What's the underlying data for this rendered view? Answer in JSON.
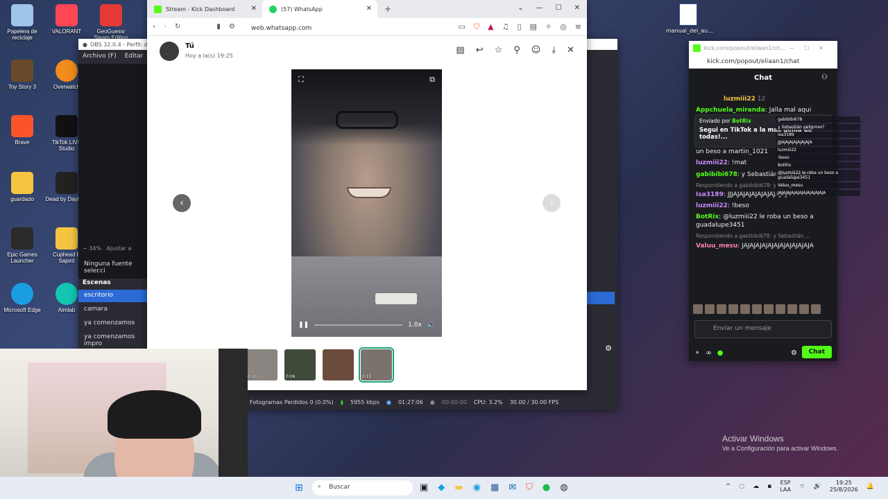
{
  "desktop": {
    "icons": [
      {
        "label": "Papelera de reciclaje",
        "color": "#9fc5e8"
      },
      {
        "label": "VALORANT",
        "color": "#ff4655"
      },
      {
        "label": "GeoGuessr Steam Edition",
        "color": "#e53935"
      },
      {
        "label": "Toy Story 3",
        "color": "#6a4a2a"
      },
      {
        "label": "Overwatch",
        "color": "#f28c1d"
      },
      {
        "label": "Brave",
        "color": "#fb542b"
      },
      {
        "label": "TikTok LIVE Studio",
        "color": "#111111"
      },
      {
        "label": "guardado",
        "color": "#f5c542"
      },
      {
        "label": "Dead by Daylight",
        "color": "#222222"
      },
      {
        "label": "Epic Games Launcher",
        "color": "#2a2a2a"
      },
      {
        "label": "Cuphead B Sajord",
        "color": "#f5c542"
      },
      {
        "label": "Microsoft Edge",
        "color": "#1b9de2"
      },
      {
        "label": "Aimlab",
        "color": "#13c6b3"
      }
    ],
    "file_icon": "manual_del_au...",
    "activate": {
      "title": "Activar Windows",
      "subtitle": "Ve a Configuración para activar Windows."
    }
  },
  "obs": {
    "title": "OBS 32.0.4 - Perfil: dir",
    "menu": [
      "Archivo (F)",
      "Editar",
      "V"
    ],
    "zoom": "34%",
    "zoom_label": "Ajustar a",
    "no_source": "Ninguna fuente selecci",
    "scenes_title": "Escenas",
    "scenes": [
      "escritorio",
      "camara",
      "ya comenzamos",
      "ya comenzamos impro"
    ],
    "status": {
      "dropped": "Fotogramas Perdidos 0 (0.0%)",
      "bitrate": "5955 kbps",
      "live_time": "01:27:06",
      "rec_time": "00:00:00",
      "cpu": "CPU: 3.2%",
      "fps": "30.00 / 30.00 FPS"
    }
  },
  "browser": {
    "tabs": [
      {
        "label": "Stream - Kick Dashboard",
        "color": "#53fc18"
      },
      {
        "label": "(57) WhatsApp",
        "color": "#25d366"
      }
    ],
    "url": "web.whatsapp.com"
  },
  "whatsapp": {
    "sender": "Tú",
    "time": "Hoy a la(s) 19:25",
    "video": {
      "speed": "1.0x",
      "progress": 0.0
    },
    "thumbs": [
      {
        "dur": "0:10",
        "color": "#8a8580"
      },
      {
        "dur": "0:06",
        "color": "#3f4a3a"
      },
      {
        "dur": "",
        "color": "#6a4b3c"
      },
      {
        "dur": "0:15",
        "color": "#7a726c"
      }
    ]
  },
  "kick": {
    "window_title": "kick.com/popout/eliaan1/ch...",
    "url": "kick.com/popout/eliaan1/chat",
    "header": "Chat",
    "pinned": {
      "by_label": "Enviado por",
      "by_user": "BotRix",
      "text": "Segui en TikTok a la mas genia de todas!..."
    },
    "messages": [
      {
        "user": "luzmiii22",
        "text": "12",
        "color": "#f5c542"
      },
      {
        "user": "Appchuela_miranda",
        "text": "Jalla mal aqui",
        "color": "#53fc18"
      },
      {
        "user": "",
        "text": "un beso a martin_1021",
        "color": "#eeeeee"
      },
      {
        "user": "luzmiii22",
        "text": "!mat",
        "color": "#c98bff"
      },
      {
        "user": "gabibibi678",
        "text": "y Sebastián peligroso?",
        "color": "#53fc18"
      },
      {
        "user": "Isa3189",
        "text": "JJJAJAJAJAJAJAJAJAJAJA",
        "color": "#c98bff",
        "reply": "Respondiendo a gabibibi678: y Sebastián ..."
      },
      {
        "user": "luzmiii22",
        "text": "!beso",
        "color": "#c98bff"
      },
      {
        "user": "BotRix",
        "text": "@luzmiii22 le roba un beso a guadalupe3451",
        "color": "#53fc18"
      },
      {
        "user": "Valuu_mesu",
        "text": "JAJAJAJAJAJAJAJAJAJAJAJA",
        "color": "#ff7eb6",
        "reply": "Respondiendo a gabibibi678: y Sebastián ..."
      }
    ],
    "overlay": [
      "gabibibi678",
      "y Sebastián peligroso?",
      "isa3189",
      "JJJAJAJAJAJAJAJAJA",
      "luzmiii22",
      "!beso",
      "BotRix",
      "@luzmiii22 le roba un beso a guadalupe3451",
      "Valuu_mesu",
      "JAJAJAJAJAJAJAJAJAJAJAJA"
    ],
    "input_placeholder": "Enviar un mensaje",
    "chat_button": "Chat"
  },
  "taskbar": {
    "search": "Buscar",
    "lang": "ESP",
    "lang2": "LAA",
    "time": "19:25",
    "date": "25/8/2026"
  }
}
